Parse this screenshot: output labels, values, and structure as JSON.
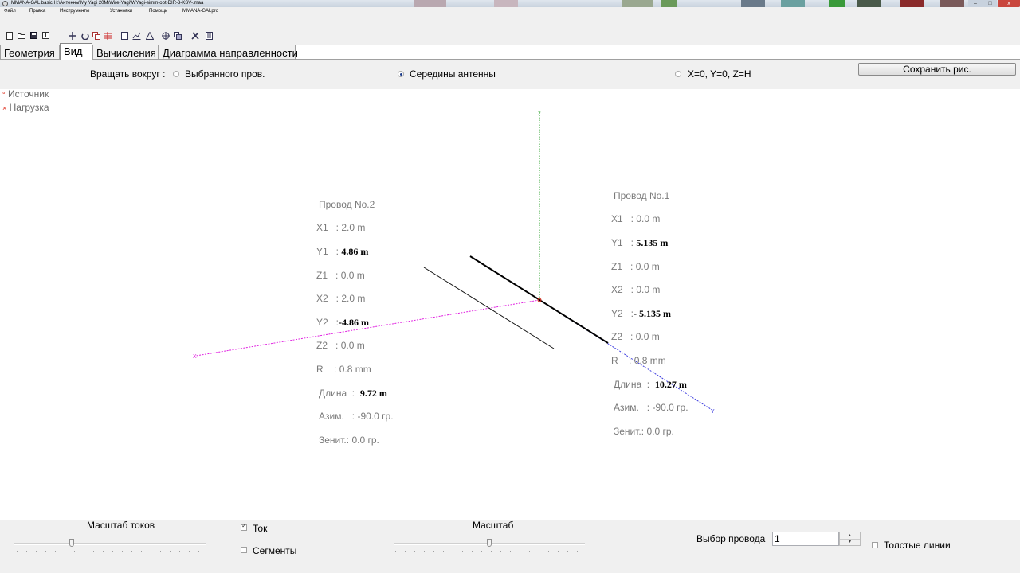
{
  "window": {
    "title": "MMANA-GAL basic H:\\Антенны\\My Yagi 20M\\Wire-Yagi\\WYagi-simm-opt-DIR-3-KSV-.maa",
    "minimize_glyph": "–",
    "maximize_glyph": "□",
    "close_glyph": "x"
  },
  "menu": [
    "Файл",
    "Правка",
    "Инструменты",
    "Установки",
    "Помощь",
    "MMANA-GALpro"
  ],
  "toolbar_icons": [
    "new-icon",
    "open-icon",
    "save-icon",
    "info-icon",
    "move-icon",
    "rotate-icon",
    "copy-icon",
    "lines-icon",
    "page-icon",
    "chart-icon",
    "triangle-icon",
    "target-icon",
    "copy2-icon",
    "tools-icon",
    "calc-icon"
  ],
  "tabs": [
    "Геометрия",
    "Вид",
    "Вычисления",
    "Диаграмма направленности"
  ],
  "active_tab": "Вид",
  "options": {
    "rotate_label": "Вращать вокруг :",
    "radio_selected_wire": "Выбранного пров.",
    "radio_center": "Середины антенны",
    "radio_origin": "X=0, Y=0, Z=H",
    "selected": "Середины антенны",
    "save_button": "Сохранить рис."
  },
  "legend": {
    "source": "Источник",
    "load": "Нагрузка",
    "source_color": "#e03020",
    "load_color": "#e03020"
  },
  "axes": {
    "z_label": "Z",
    "x_label": "X",
    "y_label": "Y",
    "z_color": "#2aa02a",
    "x_color": "#e020e0",
    "y_color": "#4040e0"
  },
  "wire2": {
    "header": "Провод No.2",
    "x1_label": "X1   :",
    "x1": "2.0 m",
    "y1_label": "Y1   :",
    "y1": "4.86 m",
    "z1_label": "Z1   :",
    "z1": "0.0 m",
    "x2_label": "X2   :",
    "x2": "2.0 m",
    "y2_label": "Y2   :",
    "y2": "-4.86 m",
    "z2_label": "Z2   :",
    "z2": "0.0 m",
    "r_label": "R    :",
    "r": "0.8 mm",
    "len_label": "Длина  :",
    "len": "9.72 m",
    "az_label": "Азим.   :",
    "az": "-90.0 гр.",
    "zen_label": "Зенит.:",
    "zen": "0.0 гр."
  },
  "wire1": {
    "header": "Провод No.1",
    "x1_label": "X1   :",
    "x1": "0.0 m",
    "y1_label": "Y1   :",
    "y1": "5.135 m",
    "z1_label": "Z1   :",
    "z1": "0.0 m",
    "x2_label": "X2   :",
    "x2": "0.0 m",
    "y2_label": "Y2   :",
    "y2": "- 5.135 m",
    "z2_label": "Z2   :",
    "z2": "0.0 m",
    "r_label": "R    :",
    "r": "0.8 mm",
    "len_label": "Длина  :",
    "len": "10.27 m",
    "az_label": "Азим.   :",
    "az": "-90.0 гр.",
    "zen_label": "Зенит.:",
    "zen": "0.0 гр."
  },
  "bottom": {
    "current_scale_label": "Масштаб токов",
    "current_label": "Ток",
    "current_checked": true,
    "segments_label": "Сегменты",
    "segments_checked": false,
    "scale_label": "Масштаб",
    "wire_select_label": "Выбор провода",
    "wire_select_value": "1",
    "thick_lines_label": "Толстые линии",
    "thick_lines_checked": false,
    "current_scale_level": 0.3,
    "scale_level": 0.5
  }
}
